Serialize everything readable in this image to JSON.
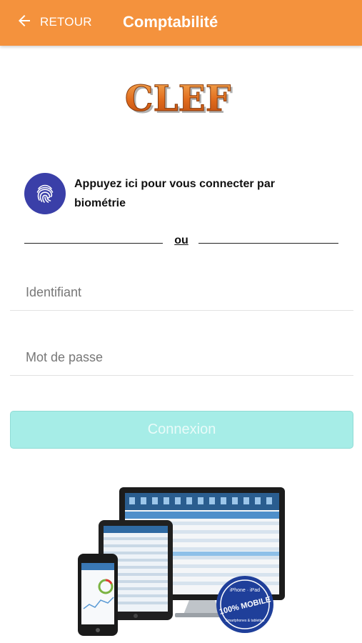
{
  "appbar": {
    "back_label": "RETOUR",
    "title": "Comptabilité",
    "background": "#f4923d"
  },
  "logo": {
    "text": "CLEF"
  },
  "biometric": {
    "label": "Appuyez ici pour vous connecter par biométrie",
    "icon": "fingerprint-icon",
    "color": "#3a3fa8"
  },
  "separator": {
    "text": "ou"
  },
  "login": {
    "username_placeholder": "Identifiant",
    "password_placeholder": "Mot de passe",
    "submit_label": "Connexion",
    "submit_color": "#a6ede7"
  },
  "promo": {
    "badge_text": "100% MOBILE",
    "badge_top": "iPhone · iPad",
    "badge_bottom": "Smartphones & tablettes"
  }
}
